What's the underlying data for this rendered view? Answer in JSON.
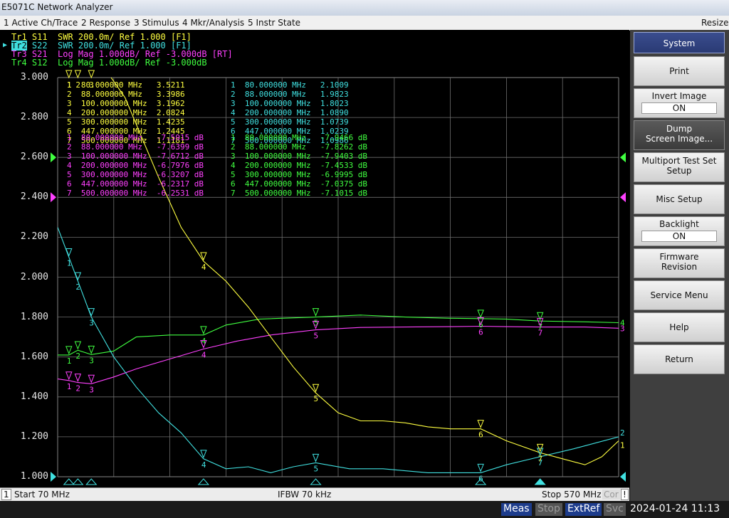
{
  "window": {
    "title": "E5071C Network Analyzer"
  },
  "menu": {
    "items": [
      "1 Active Ch/Trace",
      "2 Response",
      "3 Stimulus",
      "4 Mkr/Analysis",
      "5 Instr State"
    ],
    "resize_label": "Resize"
  },
  "traces": [
    {
      "label": "Tr1",
      "text": "S11  SWR 200.0m/ Ref 1.000 [F1]",
      "color": "#ffff40",
      "active": false
    },
    {
      "label": "Tr2",
      "text": "S22  SWR 200.0m/ Ref 1.000 [F1]",
      "color": "#40e0e0",
      "active": true
    },
    {
      "label": "Tr3",
      "text": "S21  Log Mag 1.000dB/ Ref -3.000dB [RT]",
      "color": "#ff40ff",
      "active": false
    },
    {
      "label": "Tr4",
      "text": "S12  Log Mag 1.000dB/ Ref -3.000dB",
      "color": "#40ff40",
      "active": false
    }
  ],
  "y_axis": {
    "labels": [
      "3.000",
      "2.800",
      "2.600",
      "2.400",
      "2.200",
      "2.000",
      "1.800",
      "1.600",
      "1.400",
      "1.200",
      "1.000"
    ]
  },
  "marker_tables": {
    "tr1": {
      "color": "#ffff40",
      "rows": [
        {
          "n": "1",
          "f": "80.000000 MHz",
          "v": "3.5211"
        },
        {
          "n": "2",
          "f": "88.000000 MHz",
          "v": "3.3986"
        },
        {
          "n": "3",
          "f": "100.000000 MHz",
          "v": "3.1962"
        },
        {
          "n": "4",
          "f": "200.000000 MHz",
          "v": "2.0824"
        },
        {
          "n": "5",
          "f": "300.000000 MHz",
          "v": "1.4235"
        },
        {
          "n": "6",
          "f": "447.000000 MHz",
          "v": "1.2445"
        },
        {
          "n": "7",
          "f": "500.000000 MHz",
          "v": "1.1181"
        }
      ]
    },
    "tr2": {
      "color": "#40e0e0",
      "rows": [
        {
          "n": "1",
          "f": "80.000000 MHz",
          "v": "2.1009"
        },
        {
          "n": "2",
          "f": "88.000000 MHz",
          "v": "1.9823"
        },
        {
          "n": "3",
          "f": "100.000000 MHz",
          "v": "1.8023"
        },
        {
          "n": "4",
          "f": "200.000000 MHz",
          "v": "1.0890"
        },
        {
          "n": "5",
          "f": "300.000000 MHz",
          "v": "1.0739"
        },
        {
          "n": "6",
          "f": "447.000000 MHz",
          "v": "1.0239"
        },
        {
          "n": "7",
          "f": "500.000000 MHz",
          "v": "1.0986"
        }
      ]
    },
    "tr3": {
      "color": "#ff40ff",
      "rows": [
        {
          "n": "1",
          "f": "80.000000 MHz",
          "v": "-7.5915 dB"
        },
        {
          "n": "2",
          "f": "88.000000 MHz",
          "v": "-7.6399 dB"
        },
        {
          "n": "3",
          "f": "100.000000 MHz",
          "v": "-7.6712 dB"
        },
        {
          "n": "4",
          "f": "200.000000 MHz",
          "v": "-6.7976 dB"
        },
        {
          "n": "5",
          "f": "300.000000 MHz",
          "v": "-6.3207 dB"
        },
        {
          "n": "6",
          "f": "447.000000 MHz",
          "v": "-6.2317 dB"
        },
        {
          "n": "7",
          "f": "500.000000 MHz",
          "v": "-6.2531 dB"
        }
      ]
    },
    "tr4": {
      "color": "#40ff40",
      "rows": [
        {
          "n": "1",
          "f": "80.000000 MHz",
          "v": "-7.9466 dB"
        },
        {
          "n": "2",
          "f": "88.000000 MHz",
          "v": "-7.8262 dB"
        },
        {
          "n": "3",
          "f": "100.000000 MHz",
          "v": "-7.9403 dB"
        },
        {
          "n": "4",
          "f": "200.000000 MHz",
          "v": "-7.4533 dB"
        },
        {
          "n": "5",
          "f": "300.000000 MHz",
          "v": "-6.9995 dB"
        },
        {
          "n": "6",
          "f": "447.000000 MHz",
          "v": "-7.0375 dB"
        },
        {
          "n": "7",
          "f": "500.000000 MHz",
          "v": "-7.1015 dB"
        }
      ]
    }
  },
  "status": {
    "channel": "1",
    "start": "Start 70 MHz",
    "ifbw": "IFBW 70 kHz",
    "stop": "Stop 570 MHz",
    "cor": "Cor",
    "warn": "!"
  },
  "softkeys": {
    "title": "System",
    "print": "Print",
    "invert_image": "Invert Image",
    "invert_state": "ON",
    "dump_1": "Dump",
    "dump_2": "Screen Image...",
    "multiport_1": "Multiport Test Set",
    "multiport_2": "Setup",
    "misc_setup": "Misc Setup",
    "backlight": "Backlight",
    "backlight_state": "ON",
    "firmware_1": "Firmware",
    "firmware_2": "Revision",
    "service_menu": "Service Menu",
    "help": "Help",
    "return": "Return"
  },
  "bottom": {
    "meas": "Meas",
    "stop": "Stop",
    "extref": "ExtRef",
    "svc": "Svc",
    "datetime": "2024-01-24 11:13"
  },
  "colors": {
    "grid": "#6e6e6e",
    "trace1": "#ffff40",
    "trace2": "#40e0e0",
    "trace3": "#ff40ff",
    "trace4": "#40ff40"
  }
}
